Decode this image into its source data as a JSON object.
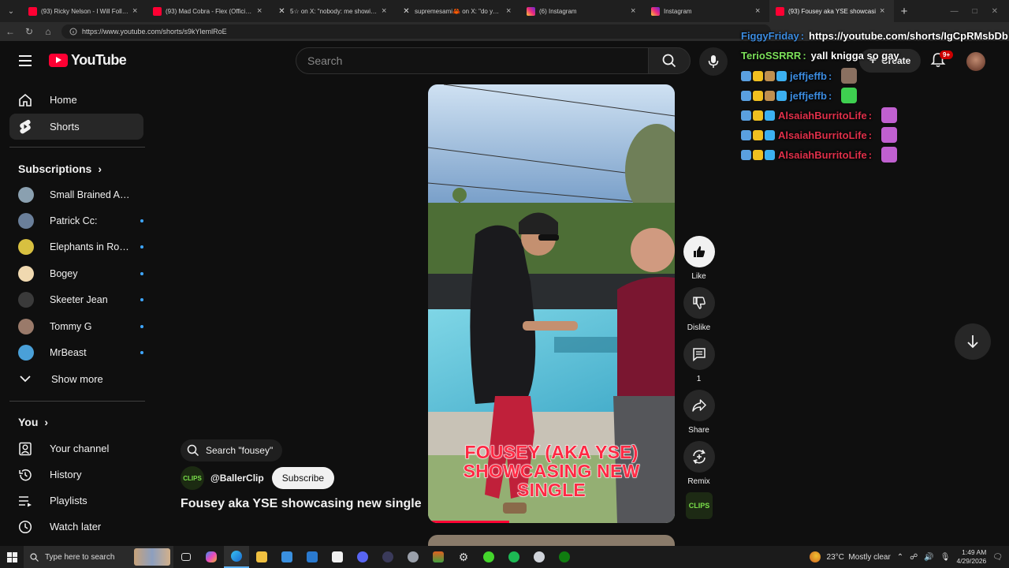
{
  "browser": {
    "tabs": [
      {
        "label": "(93) Ricky Nelson - I Will Follow Yo",
        "favicon": "youtube-icon"
      },
      {
        "label": "(93) Mad Cobra - Flex (Official Vide",
        "favicon": "youtube-icon"
      },
      {
        "label": "5☆ on X: \"nobody: me showing hi",
        "favicon": "x-icon"
      },
      {
        "label": "supremesami🦀 on X: \"do you lik",
        "favicon": "x-icon"
      },
      {
        "label": "(6) Instagram",
        "favicon": "instagram-icon"
      },
      {
        "label": "Instagram",
        "favicon": "instagram-icon"
      },
      {
        "label": "(93) Fousey aka YSE showcasi",
        "favicon": "youtube-icon"
      }
    ],
    "url": "https://www.youtube.com/shorts/s9kYlemlRoE"
  },
  "youtube": {
    "logo_text": "YouTube",
    "search_placeholder": "Search",
    "create_label": "Create",
    "notification_count": "9+",
    "nav": [
      {
        "label": "Home",
        "icon": "home-icon"
      },
      {
        "label": "Shorts",
        "icon": "shorts-icon"
      }
    ],
    "subscriptions_heading": "Subscriptions",
    "subscriptions": [
      {
        "name": "Small Brained Ame...",
        "color": "#8aa0b0",
        "new": false
      },
      {
        "name": "Patrick Cc:",
        "color": "#6a7f9a",
        "new": true
      },
      {
        "name": "Elephants in Roo...",
        "color": "#d8c040",
        "new": true
      },
      {
        "name": "Bogey",
        "color": "#f0d9b0",
        "new": true
      },
      {
        "name": "Skeeter Jean",
        "color": "#3a3a3a",
        "new": true
      },
      {
        "name": "Tommy G",
        "color": "#9a7a6a",
        "new": true
      },
      {
        "name": "MrBeast",
        "color": "#4aa0d8",
        "new": true
      }
    ],
    "show_more": "Show more",
    "you_heading": "You",
    "you_items": [
      {
        "label": "Your channel",
        "icon": "user-square-icon"
      },
      {
        "label": "History",
        "icon": "history-icon"
      },
      {
        "label": "Playlists",
        "icon": "playlists-icon"
      },
      {
        "label": "Watch later",
        "icon": "clock-icon"
      }
    ]
  },
  "short": {
    "caption": [
      "FOUSEY (AKA YSE)",
      "SHOWCASING NEW",
      "SINGLE"
    ],
    "search_chip": "Search \"fousey\"",
    "channel_handle": "@BallerClip",
    "channel_avatar_text": "CLIPS",
    "subscribe_label": "Subscribe",
    "title": "Fousey aka YSE showcasing new single",
    "progress_percent": 33,
    "actions": {
      "like": "Like",
      "dislike": "Dislike",
      "comments": "1",
      "share": "Share",
      "remix": "Remix"
    }
  },
  "chat_overlay": [
    {
      "user": "FiggyFriday",
      "user_color": "#3c8ce0",
      "message": "https://youtube.com/shorts/IgCpRMsbDb",
      "badges": [],
      "emote": null
    },
    {
      "user": "TerioSSRRR",
      "user_color": "#7ce05a",
      "message": "yall knigga so gay",
      "badges": [],
      "emote": null
    },
    {
      "user": "jeffjeffb",
      "user_color": "#3c8ce0",
      "message": "",
      "badges": [
        "#5aa0e0",
        "#f0c020",
        "#c09050",
        "#3cb0f0"
      ],
      "emote": "#8a7060"
    },
    {
      "user": "jeffjeffb",
      "user_color": "#3c8ce0",
      "message": "",
      "badges": [
        "#5aa0e0",
        "#f0c020",
        "#c09050",
        "#3cb0f0"
      ],
      "emote": "#3ed050"
    },
    {
      "user": "AlsaiahBurritoLife",
      "user_color": "#e0304a",
      "message": "",
      "badges": [
        "#5aa0e0",
        "#f0c020",
        "#3cb0f0"
      ],
      "emote": "#c060d0"
    },
    {
      "user": "AlsaiahBurritoLife",
      "user_color": "#e0304a",
      "message": "",
      "badges": [
        "#5aa0e0",
        "#f0c020",
        "#3cb0f0"
      ],
      "emote": "#c060d0"
    },
    {
      "user": "AlsaiahBurritoLife",
      "user_color": "#e0304a",
      "message": "",
      "badges": [
        "#5aa0e0",
        "#f0c020",
        "#3cb0f0"
      ],
      "emote": "#c060d0"
    }
  ],
  "taskbar": {
    "search_placeholder": "Type here to search",
    "weather": "23°C  Mostly clear",
    "time": "1:49 AM",
    "date": "4/29/2026"
  }
}
